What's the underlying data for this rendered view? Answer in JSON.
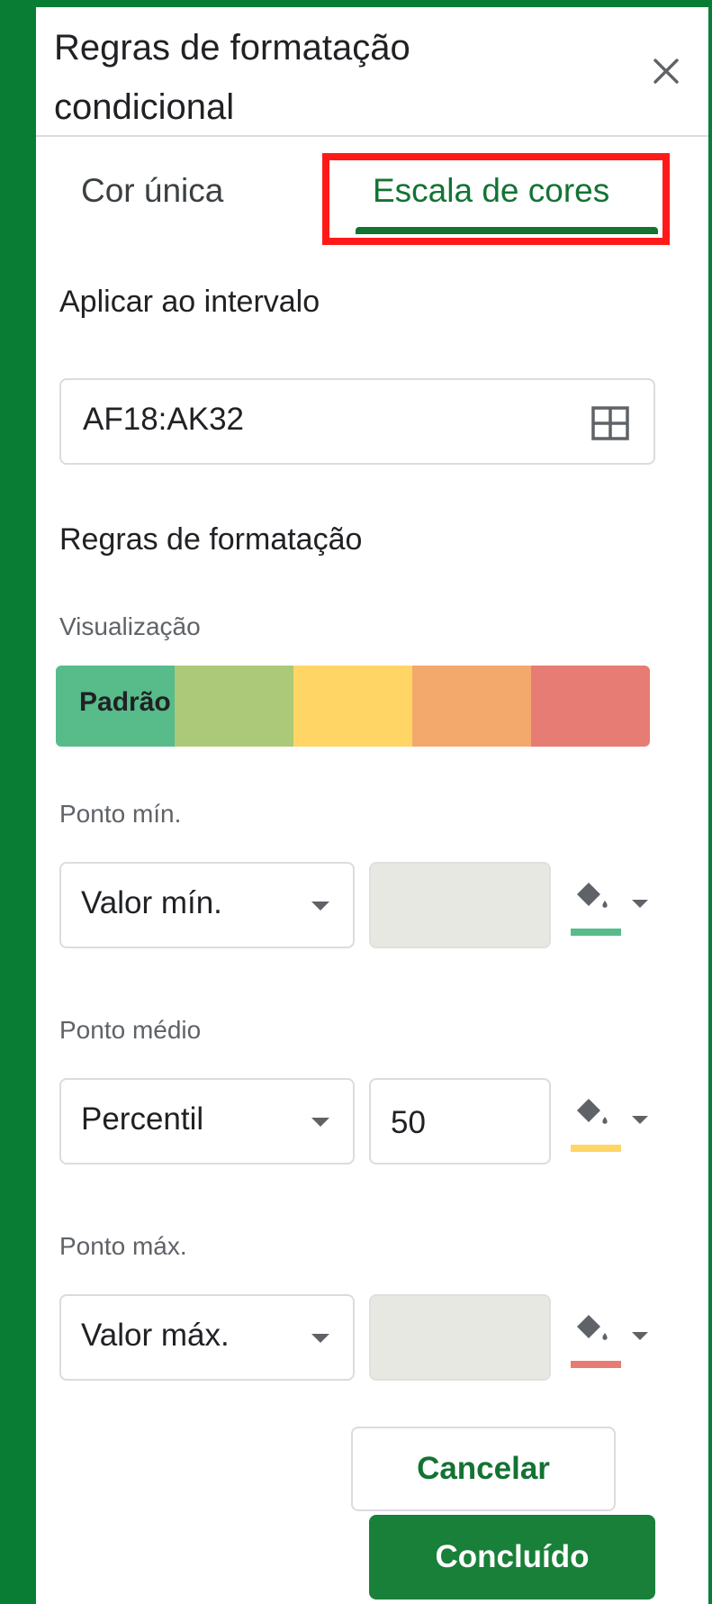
{
  "header": {
    "title": "Regras de formatação condicional",
    "close_icon": "close-icon"
  },
  "tabs": [
    {
      "label": "Cor única",
      "active": false
    },
    {
      "label": "Escala de cores",
      "active": true
    }
  ],
  "range": {
    "section_label": "Aplicar ao intervalo",
    "value": "AF18:AK32",
    "icon": "grid-select-icon"
  },
  "rules": {
    "section_label": "Regras de formatação",
    "preview_label": "Visualização",
    "preview_text": "Padrão",
    "preview_colors": [
      "#57bb8a",
      "#abc978",
      "#ffd666",
      "#f3a86c",
      "#e67c73"
    ]
  },
  "points": {
    "min": {
      "label": "Ponto mín.",
      "type": "Valor mín.",
      "value": "",
      "color": "#57bb8a"
    },
    "mid": {
      "label": "Ponto médio",
      "type": "Percentil",
      "value": "50",
      "color": "#ffd666"
    },
    "max": {
      "label": "Ponto máx.",
      "type": "Valor máx.",
      "value": "",
      "color": "#e67c73"
    }
  },
  "buttons": {
    "cancel": "Cancelar",
    "done": "Concluído"
  },
  "colors": {
    "accent": "#137333",
    "primary_button": "#188038",
    "highlight": "#ff1a1a",
    "app_background": "#0a7d35"
  }
}
